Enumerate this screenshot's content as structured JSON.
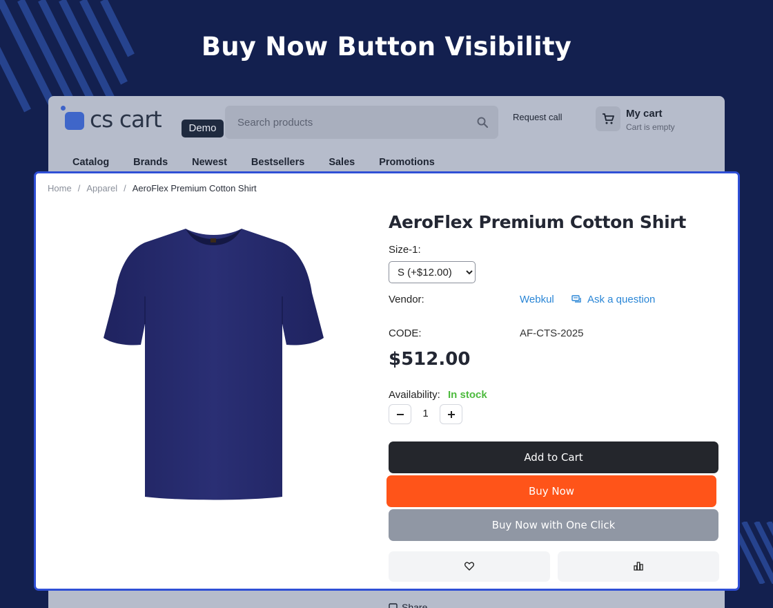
{
  "headline": "Buy Now Button Visibility",
  "header": {
    "logo_text": "cs cart",
    "demo_badge": "Demo",
    "search_placeholder": "Search products",
    "request_call": "Request call",
    "cart_title": "My cart",
    "cart_status": "Cart is empty"
  },
  "nav": [
    "Catalog",
    "Brands",
    "Newest",
    "Bestsellers",
    "Sales",
    "Promotions"
  ],
  "breadcrumb": {
    "home": "Home",
    "category": "Apparel",
    "current": "AeroFlex Premium Cotton Shirt",
    "separator": "/"
  },
  "product": {
    "title": "AeroFlex Premium Cotton Shirt",
    "size_label": "Size-1:",
    "size_selected": "S (+$12.00)",
    "vendor_label": "Vendor:",
    "vendor_name": "Webkul",
    "ask_question": "Ask a question",
    "code_label": "CODE:",
    "code_value": "AF-CTS-2025",
    "price": "$512.00",
    "availability_label": "Availability:",
    "availability_value": "In stock",
    "quantity": "1",
    "image_color": "#252a6a"
  },
  "buttons": {
    "add_to_cart": "Add to Cart",
    "buy_now": "Buy Now",
    "buy_one_click": "Buy Now with One Click",
    "share": "Share"
  },
  "colors": {
    "background": "#13204f",
    "highlight_border": "#2f4fd6",
    "buy_now": "#ff5419",
    "add_to_cart": "#24262c",
    "one_click": "#9097a4",
    "in_stock": "#4cba3d",
    "link": "#2a86d6"
  }
}
